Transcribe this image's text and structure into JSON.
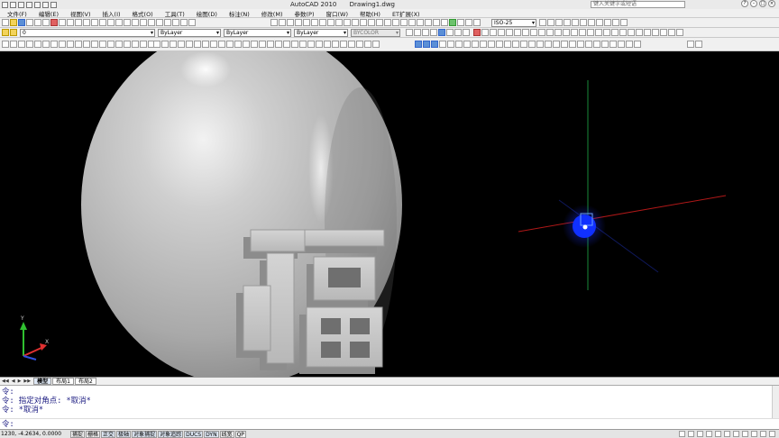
{
  "title": {
    "app": "AutoCAD 2010",
    "file": "Drawing1.dwg",
    "search_placeholder": "键入关键字或短语"
  },
  "menu": [
    "文件(F)",
    "编辑(E)",
    "视图(V)",
    "插入(I)",
    "格式(O)",
    "工具(T)",
    "绘图(D)",
    "标注(N)",
    "修改(M)",
    "参数(P)",
    "窗口(W)",
    "帮助(H)",
    "ET扩展(X)"
  ],
  "toolbars": {
    "text_style": "ISO-25",
    "layer": "0",
    "color": "ByLayer",
    "linetype": "ByLayer",
    "lineweight": "ByLayer",
    "plotstyle": "BYCOLOR"
  },
  "layout_tabs": [
    "模型",
    "布局1",
    "布局2"
  ],
  "command": {
    "lines": [
      "令:",
      "令: 指定对角点: *取消*",
      "令: *取消*"
    ],
    "prompt": "令:"
  },
  "status": {
    "coords": "1230, -4.2634, 0.0000",
    "toggles": [
      "捕捉",
      "栅格",
      "正交",
      "极轴",
      "对象捕捉",
      "对象追踪",
      "DUCS",
      "DYN",
      "线宽",
      "QP"
    ]
  },
  "colors": {
    "background": "#000000",
    "egg": "#bdbdbd",
    "ucs_x": "#e03030",
    "ucs_y": "#30c030",
    "ucs_z": "#3050e0",
    "light": "#1030ff"
  },
  "scene": {
    "character": "福"
  }
}
